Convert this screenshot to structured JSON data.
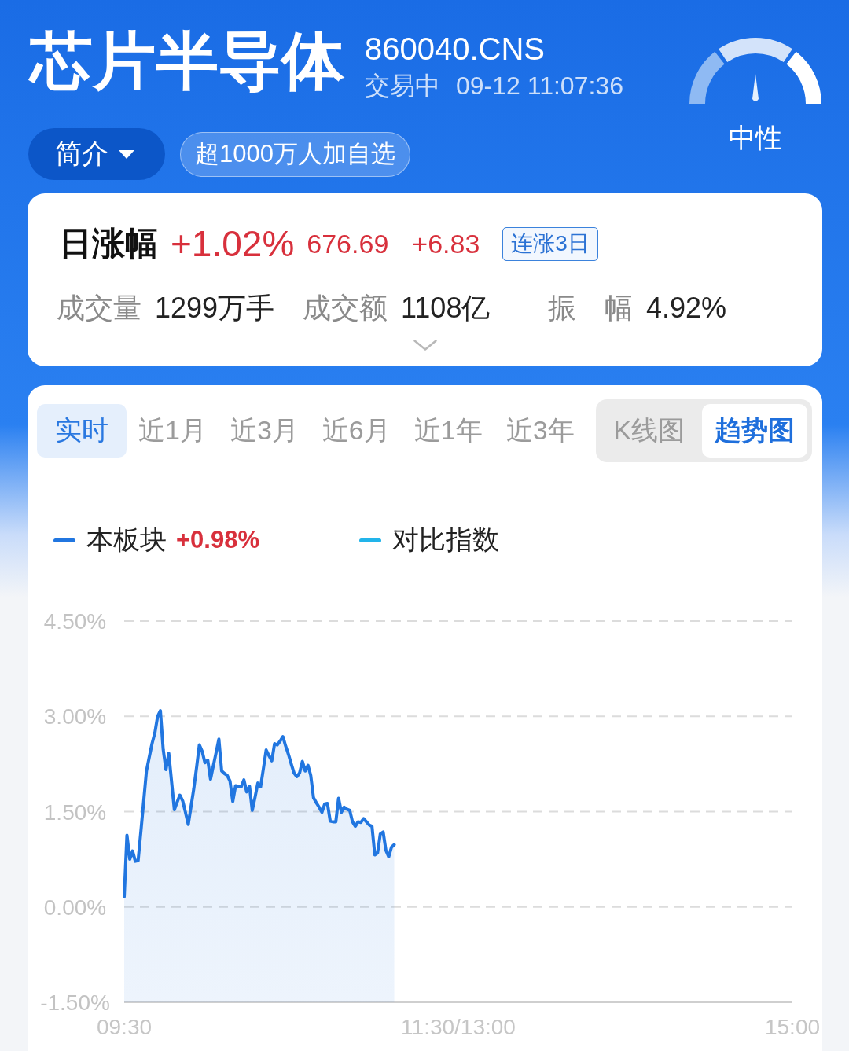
{
  "header": {
    "title": "芯片半导体",
    "code": "860040.CNS",
    "status": "交易中",
    "datetime": "09-12 11:07:36",
    "intro_button": "简介",
    "follow_badge": "超1000万人加自选",
    "sentiment": {
      "label": "中性",
      "level": 0.5
    }
  },
  "quote": {
    "label": "日涨幅",
    "change_pct": "+1.02%",
    "price": "676.69",
    "change": "+6.83",
    "streak_badge": "连涨3日",
    "stats": [
      {
        "label": "成交量",
        "value": "1299万手"
      },
      {
        "label": "成交额",
        "value": "1108亿"
      },
      {
        "label": "振　幅",
        "value": "4.92%"
      }
    ]
  },
  "chart_panel": {
    "periods": [
      {
        "label": "实时",
        "selected": true
      },
      {
        "label": "近1月",
        "selected": false
      },
      {
        "label": "近3月",
        "selected": false
      },
      {
        "label": "近6月",
        "selected": false
      },
      {
        "label": "近1年",
        "selected": false
      },
      {
        "label": "近3年",
        "selected": false
      }
    ],
    "views": [
      {
        "label": "K线图",
        "selected": false
      },
      {
        "label": "趋势图",
        "selected": true
      }
    ],
    "series_change": "+0.98%",
    "compare_index": {
      "label": "对比指数",
      "color": "#22b4ea"
    },
    "chart_data": {
      "type": "area",
      "grid": true,
      "categories": [
        "09:30",
        null,
        null,
        null,
        null,
        null,
        null,
        null,
        null,
        null,
        null,
        null,
        null,
        null,
        null,
        null,
        null,
        null,
        null,
        null,
        null,
        null,
        null,
        null,
        null,
        null,
        null,
        null,
        null,
        null,
        null,
        null,
        null,
        null,
        null,
        null,
        null,
        null,
        null,
        null,
        null,
        null,
        null,
        null,
        null,
        null,
        null,
        null,
        null,
        null,
        null,
        null,
        null,
        null,
        null,
        null,
        null,
        null,
        null,
        null,
        null,
        null,
        null,
        null,
        null,
        null,
        null,
        null,
        null,
        null,
        null,
        null,
        null,
        null,
        null,
        null,
        null,
        null,
        null,
        null,
        null,
        null,
        null,
        null,
        null,
        null,
        null,
        null,
        null,
        null,
        null,
        null,
        null,
        null,
        null,
        null,
        null,
        null,
        null,
        null,
        null,
        null,
        null,
        null,
        null,
        null,
        null,
        null,
        null,
        null,
        null,
        null,
        null,
        null,
        null,
        null,
        null,
        null,
        null,
        null,
        "11:30/13:00",
        null,
        null,
        null,
        null,
        null,
        null,
        null,
        null,
        null,
        null,
        null,
        null,
        null,
        null,
        null,
        null,
        null,
        null,
        null,
        null,
        null,
        null,
        null,
        null,
        null,
        null,
        null,
        null,
        null,
        null,
        null,
        null,
        null,
        null,
        null,
        null,
        null,
        null,
        null,
        null,
        null,
        null,
        null,
        null,
        null,
        null,
        null,
        null,
        null,
        null,
        null,
        null,
        null,
        null,
        null,
        null,
        null,
        null,
        null,
        null,
        null,
        null,
        null,
        null,
        null,
        null,
        null,
        null,
        null,
        null,
        null,
        null,
        null,
        null,
        null,
        null,
        null,
        null,
        null,
        null,
        null,
        null,
        null,
        null,
        null,
        null,
        null,
        null,
        null,
        null,
        null,
        null,
        null,
        null,
        null,
        null,
        null,
        null,
        null,
        null,
        null,
        null,
        null,
        null,
        null,
        null,
        null,
        null,
        null,
        null,
        null,
        null,
        null,
        null,
        null,
        null,
        null,
        null,
        null,
        "15:00"
      ],
      "series": [
        {
          "name": "本板块",
          "color": "#2176e0",
          "values": [
            0.16,
            1.13,
            0.75,
            0.88,
            0.72,
            0.73,
            1.2,
            1.67,
            2.14,
            2.36,
            2.57,
            2.74,
            3.0,
            3.09,
            2.48,
            2.16,
            2.42,
            1.98,
            1.53,
            1.65,
            1.76,
            1.67,
            1.49,
            1.3,
            1.58,
            1.86,
            2.2,
            2.55,
            2.45,
            2.27,
            2.31,
            2.01,
            2.22,
            2.43,
            2.64,
            2.14,
            2.1,
            2.07,
            1.98,
            1.66,
            1.91,
            1.9,
            1.89,
            2.0,
            1.81,
            1.9,
            1.52,
            1.73,
            1.95,
            1.89,
            2.18,
            2.47,
            2.38,
            2.3,
            2.57,
            2.55,
            2.61,
            2.68,
            2.53,
            2.4,
            2.25,
            2.11,
            2.05,
            2.11,
            2.29,
            2.14,
            2.23,
            2.07,
            1.72,
            1.64,
            1.57,
            1.49,
            1.62,
            1.63,
            1.35,
            1.34,
            1.34,
            1.71,
            1.49,
            1.57,
            1.54,
            1.52,
            1.34,
            1.27,
            1.34,
            1.33,
            1.39,
            1.34,
            1.29,
            1.27,
            0.82,
            0.85,
            1.15,
            1.18,
            0.89,
            0.79,
            0.94,
            0.98,
            null,
            null,
            null,
            null,
            null,
            null,
            null,
            null,
            null,
            null,
            null,
            null,
            null,
            null,
            null,
            null,
            null,
            null,
            null,
            null,
            null,
            null,
            null,
            null,
            null,
            null,
            null,
            null,
            null,
            null,
            null,
            null,
            null,
            null,
            null,
            null,
            null,
            null,
            null,
            null,
            null,
            null,
            null,
            null,
            null,
            null,
            null,
            null,
            null,
            null,
            null,
            null,
            null,
            null,
            null,
            null,
            null,
            null,
            null,
            null,
            null,
            null,
            null,
            null,
            null,
            null,
            null,
            null,
            null,
            null,
            null,
            null,
            null,
            null,
            null,
            null,
            null,
            null,
            null,
            null,
            null,
            null,
            null,
            null,
            null,
            null,
            null,
            null,
            null,
            null,
            null,
            null,
            null,
            null,
            null,
            null,
            null,
            null,
            null,
            null,
            null,
            null,
            null,
            null,
            null,
            null,
            null,
            null,
            null,
            null,
            null,
            null,
            null,
            null,
            null,
            null,
            null,
            null,
            null,
            null,
            null,
            null,
            null,
            null,
            null,
            null,
            null,
            null,
            null,
            null,
            null,
            null,
            null,
            null,
            null,
            null,
            null,
            null,
            null,
            null,
            null,
            null,
            null
          ]
        }
      ],
      "ylim": [
        -1.5,
        4.5
      ],
      "yticks": [
        {
          "value": 4.5,
          "label": "4.50%"
        },
        {
          "value": 3,
          "label": "3.00%"
        },
        {
          "value": 1.5,
          "label": "1.50%"
        },
        {
          "value": 0,
          "label": "0.00%"
        },
        {
          "value": -1.5,
          "label": "-1.50%"
        }
      ]
    }
  }
}
